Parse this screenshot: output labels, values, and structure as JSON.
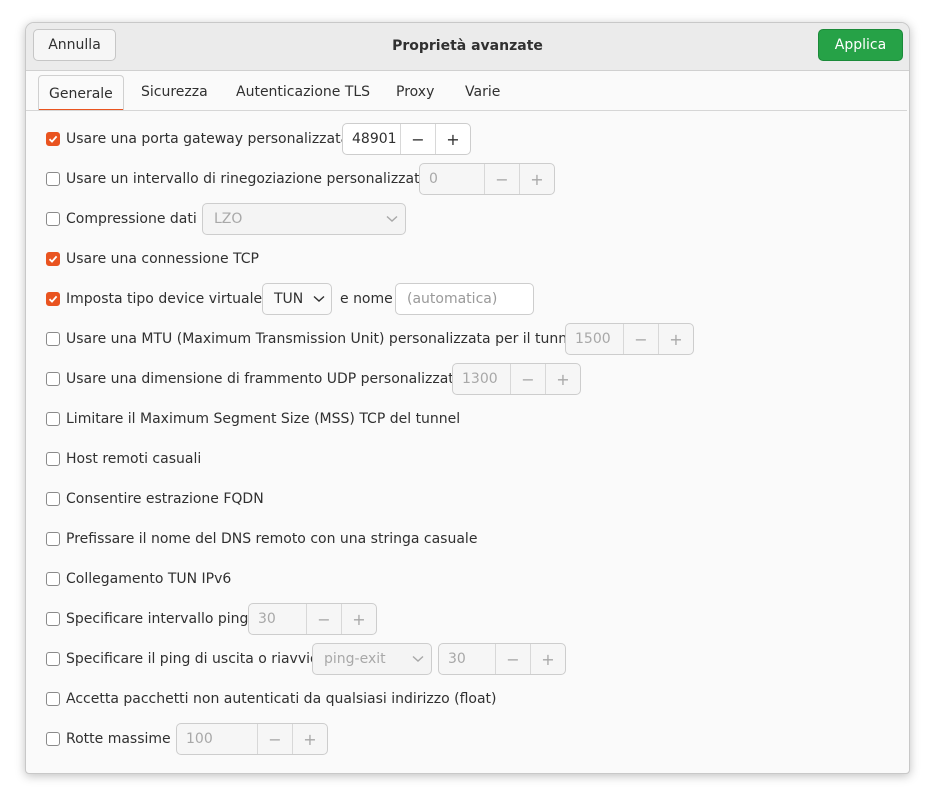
{
  "header": {
    "title": "Proprietà avanzate",
    "cancel_label": "Annulla",
    "apply_label": "Applica"
  },
  "tabs": [
    {
      "label": "Generale",
      "active": true
    },
    {
      "label": "Sicurezza",
      "active": false
    },
    {
      "label": "Autenticazione TLS",
      "active": false
    },
    {
      "label": "Proxy",
      "active": false
    },
    {
      "label": "Varie",
      "active": false
    }
  ],
  "colors": {
    "accent": "#e95420",
    "apply_green": "#26a247"
  },
  "options": {
    "gateway_port": {
      "label": "Usare una porta gateway personalizzata",
      "checked": true,
      "value": "48901"
    },
    "renegotiation": {
      "label": "Usare un intervallo di rinegoziazione personalizzato",
      "checked": false,
      "value": "0"
    },
    "compression": {
      "label": "Compressione dati",
      "checked": false,
      "selected": "LZO"
    },
    "tcp": {
      "label": "Usare una connessione TCP",
      "checked": true
    },
    "device_type": {
      "label": "Imposta tipo device virtuale",
      "checked": true,
      "selected": "TUN",
      "name_label": "e nome",
      "name_placeholder": "(automatica)"
    },
    "mtu": {
      "label": "Usare una MTU (Maximum Transmission Unit) personalizzata per il tunnel:",
      "checked": false,
      "value": "1500"
    },
    "fragment": {
      "label": "Usare una dimensione di frammento UDP personalizzata",
      "checked": false,
      "value": "1300"
    },
    "mss": {
      "label": "Limitare il Maximum Segment Size (MSS) TCP del tunnel",
      "checked": false
    },
    "random_hosts": {
      "label": "Host remoti casuali",
      "checked": false
    },
    "fqdn": {
      "label": "Consentire estrazione FQDN",
      "checked": false
    },
    "dns_prefix": {
      "label": "Prefissare il nome del DNS remoto con una stringa casuale",
      "checked": false
    },
    "tun_ipv6": {
      "label": "Collegamento TUN IPv6",
      "checked": false
    },
    "ping_interval": {
      "label": "Specificare intervallo ping",
      "checked": false,
      "value": "30"
    },
    "ping_exit": {
      "label": "Specificare il ping di uscita o riavvio",
      "checked": false,
      "selected": "ping-exit",
      "value": "30"
    },
    "float": {
      "label": "Accetta pacchetti non autenticati da qualsiasi indirizzo (float)",
      "checked": false
    },
    "max_routes": {
      "label": "Rotte massime",
      "checked": false,
      "value": "100"
    }
  },
  "icons": {
    "minus": "−",
    "plus": "+",
    "chevron": "chevron-down-icon",
    "check": "checkmark-icon"
  }
}
